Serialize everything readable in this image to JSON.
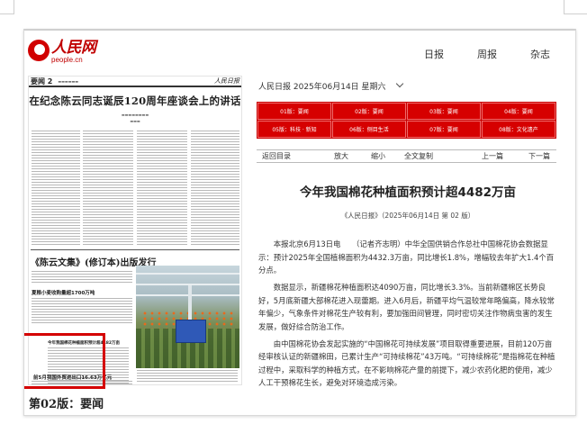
{
  "header": {
    "logo_cn": "人民网",
    "logo_en": "people.cn",
    "nav": [
      "日报",
      "周报",
      "杂志"
    ]
  },
  "paper_preview": {
    "page_no": "要闻 2",
    "masthead": "人民日报",
    "main_title": "在纪念陈云同志诞辰120周年座谈会上的讲话",
    "book_headline": "《陈云文集》(修订本)出版发行",
    "headline_2": "夏粮小麦收购量超1700万吨",
    "highlight_title": "今年我国棉花种植面积预计超4482万亩",
    "headline_3": "前5月我国外贸进出口16.63万亿元",
    "caption": "第02版：要闻"
  },
  "edition": {
    "dateline": "人民日报   2025年06月14日  星期六",
    "pages": [
      "01版：要闻",
      "02版：要闻",
      "03版：要闻",
      "04版：要闻",
      "05版：科技 · 新知",
      "06版：侧目生活",
      "07版：要闻",
      "08版：文化遗产"
    ]
  },
  "toolbar": {
    "back": "返回目录",
    "zoom_in": "放大",
    "zoom_out": "缩小",
    "copy_all": "全文复制",
    "prev": "上一篇",
    "next": "下一篇"
  },
  "article": {
    "title": "今年我国棉花种植面积预计超4482万亩",
    "source": "《人民日报》（2025年06月14日   第  02  版）",
    "paragraphs": [
      "本报北京6月13日电　　（记者齐志明）中华全国供销合作总社中国棉花协会数据显示：预计2025年全国植棉面积为4432.3万亩，同比增长1.8%，增幅较去年扩大1.4个百分点。",
      "数据显示，新疆棉花种植面积达4090万亩，同比增长3.3%。当前新疆棉区长势良好，5月底新疆大部棉花进入现蕾期。进入6月后，新疆平均气温较常年略偏高，降水较常年偏少，气象条件对棉花生产较有利，要加强田间管理，同时密切关注作物病虫害的发生发展，做好综合防治工作。",
      "由中国棉花协会发起实施的“中国棉花可持续发展”项目取得重要进展，目前120万亩经审核认证的新疆棉田，已累计生产“可持续棉花”43万吨。“可持续棉花”是指棉花在种植过程中，采取科学的种植方式，在不影响棉花产量的前提下，减少农药化肥的使用，减少人工干预棉花生长，避免对环境造成污染。"
    ]
  },
  "colors": {
    "brand_red": "#d60000",
    "highlight_red": "#d40000"
  }
}
